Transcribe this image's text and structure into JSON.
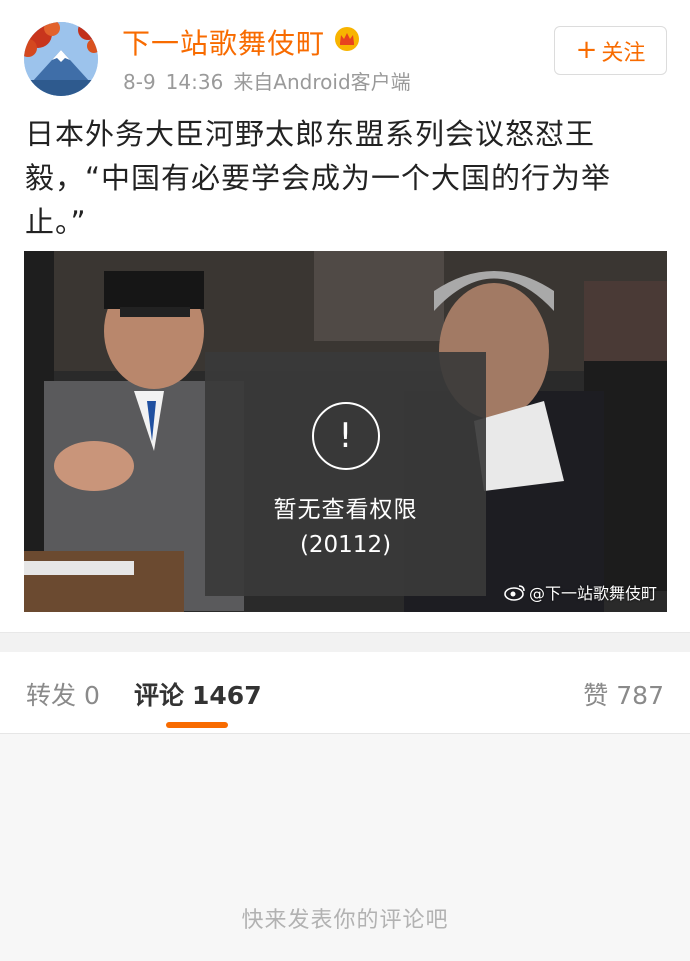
{
  "header": {
    "username": "下一站歌舞伎町",
    "date": "8-9",
    "time": "14:36",
    "source": "来自Android客户端",
    "follow_label": "关注",
    "follow_plus": "+"
  },
  "post": {
    "text": "日本外务大臣河野太郎东盟系列会议怒怼王毅，“中国有必要学会成为一个大国的行为举止。”"
  },
  "image": {
    "message": "暂无查看权限",
    "code": "(20112)",
    "watermark": "@下一站歌舞伎町"
  },
  "tabs": {
    "repost_label": "转发",
    "repost_count": "0",
    "comment_label": "评论",
    "comment_count": "1467",
    "like_label": "赞",
    "like_count": "787"
  },
  "comments": {
    "empty_hint": "快来发表你的评论吧"
  },
  "colors": {
    "accent": "#f86b00",
    "muted": "#9a9a9a",
    "background_gray": "#f7f7f7"
  },
  "icons": {
    "avatar": "mountain-avatar",
    "vip": "crown-icon",
    "alert": "exclamation-circle-icon",
    "watermark": "weibo-icon"
  }
}
